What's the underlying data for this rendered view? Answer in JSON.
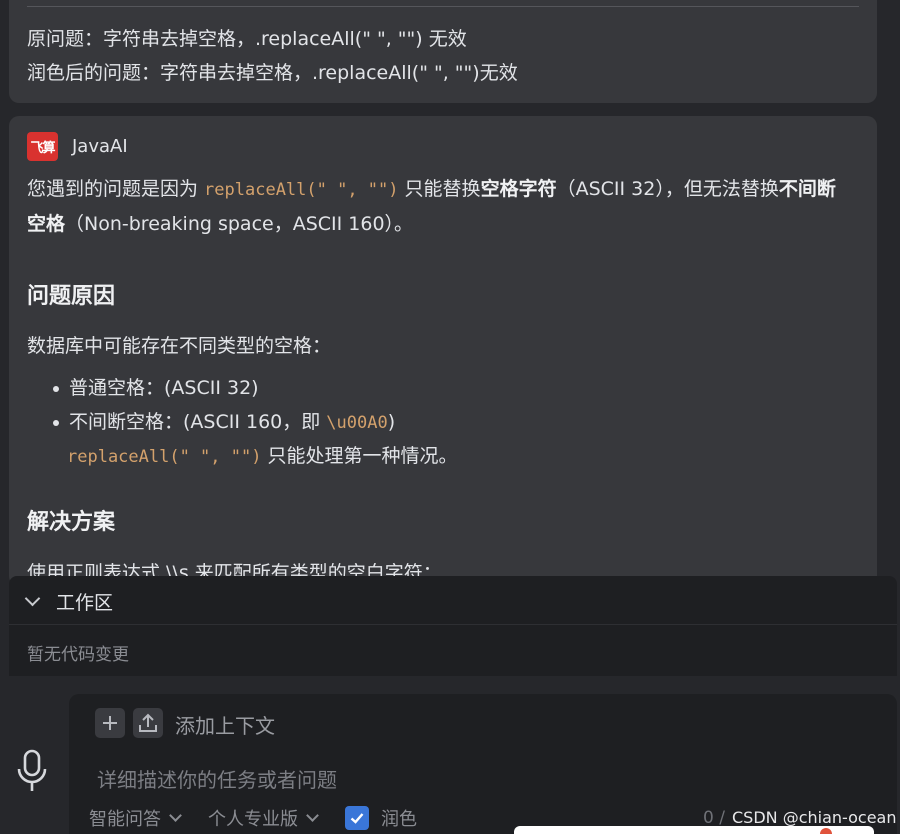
{
  "question": {
    "original": "原问题：字符串去掉空格，.replaceAll(\" \", \"\") 无效",
    "polished": "润色后的问题：字符串去掉空格，.replaceAll(\" \", \"\")无效"
  },
  "answer": {
    "logo_text": "飞算",
    "name": "JavaAI",
    "p1_a": "您遇到的问题是因为 ",
    "p1_code": "replaceAll(\" \", \"\")",
    "p1_b": " 只能替换",
    "p1_bold1": "空格字符",
    "p1_c": "（ASCII 32），但无法替换",
    "p1_bold2": "不间断空格",
    "p1_d": "（Non-breaking space，ASCII 160）。",
    "h_cause": "问题原因",
    "p2": "数据库中可能存在不同类型的空格：",
    "bullet1": "普通空格：(ASCII 32)",
    "bullet2_a": "不间断空格：(ASCII 160，即 ",
    "bullet2_code": "\\u00A0",
    "bullet2_b": ")",
    "p3_code": "replaceAll(\" \", \"\")",
    "p3_text": " 只能处理第一种情况。",
    "h_solution": "解决方案",
    "p4_cut": "使用正则表达式 \\\\s 来匹配所有类型的空白字符："
  },
  "workspace": {
    "title": "工作区",
    "empty": "暂无代码变更"
  },
  "input": {
    "context_label": "添加上下文",
    "placeholder": "详细描述你的任务或者问题",
    "mode": "智能问答",
    "edition": "个人专业版",
    "polish_label": "润色",
    "polish_checked": true,
    "counter": "0 /",
    "watermark": "CSDN @chian-ocean"
  },
  "colors": {
    "accent": "#3a76d8",
    "logo_red": "#d9322f",
    "code": "#d3a16c"
  },
  "icons": [
    "plus-icon",
    "upload-icon",
    "microphone-icon",
    "chevron-down-icon",
    "check-icon"
  ]
}
